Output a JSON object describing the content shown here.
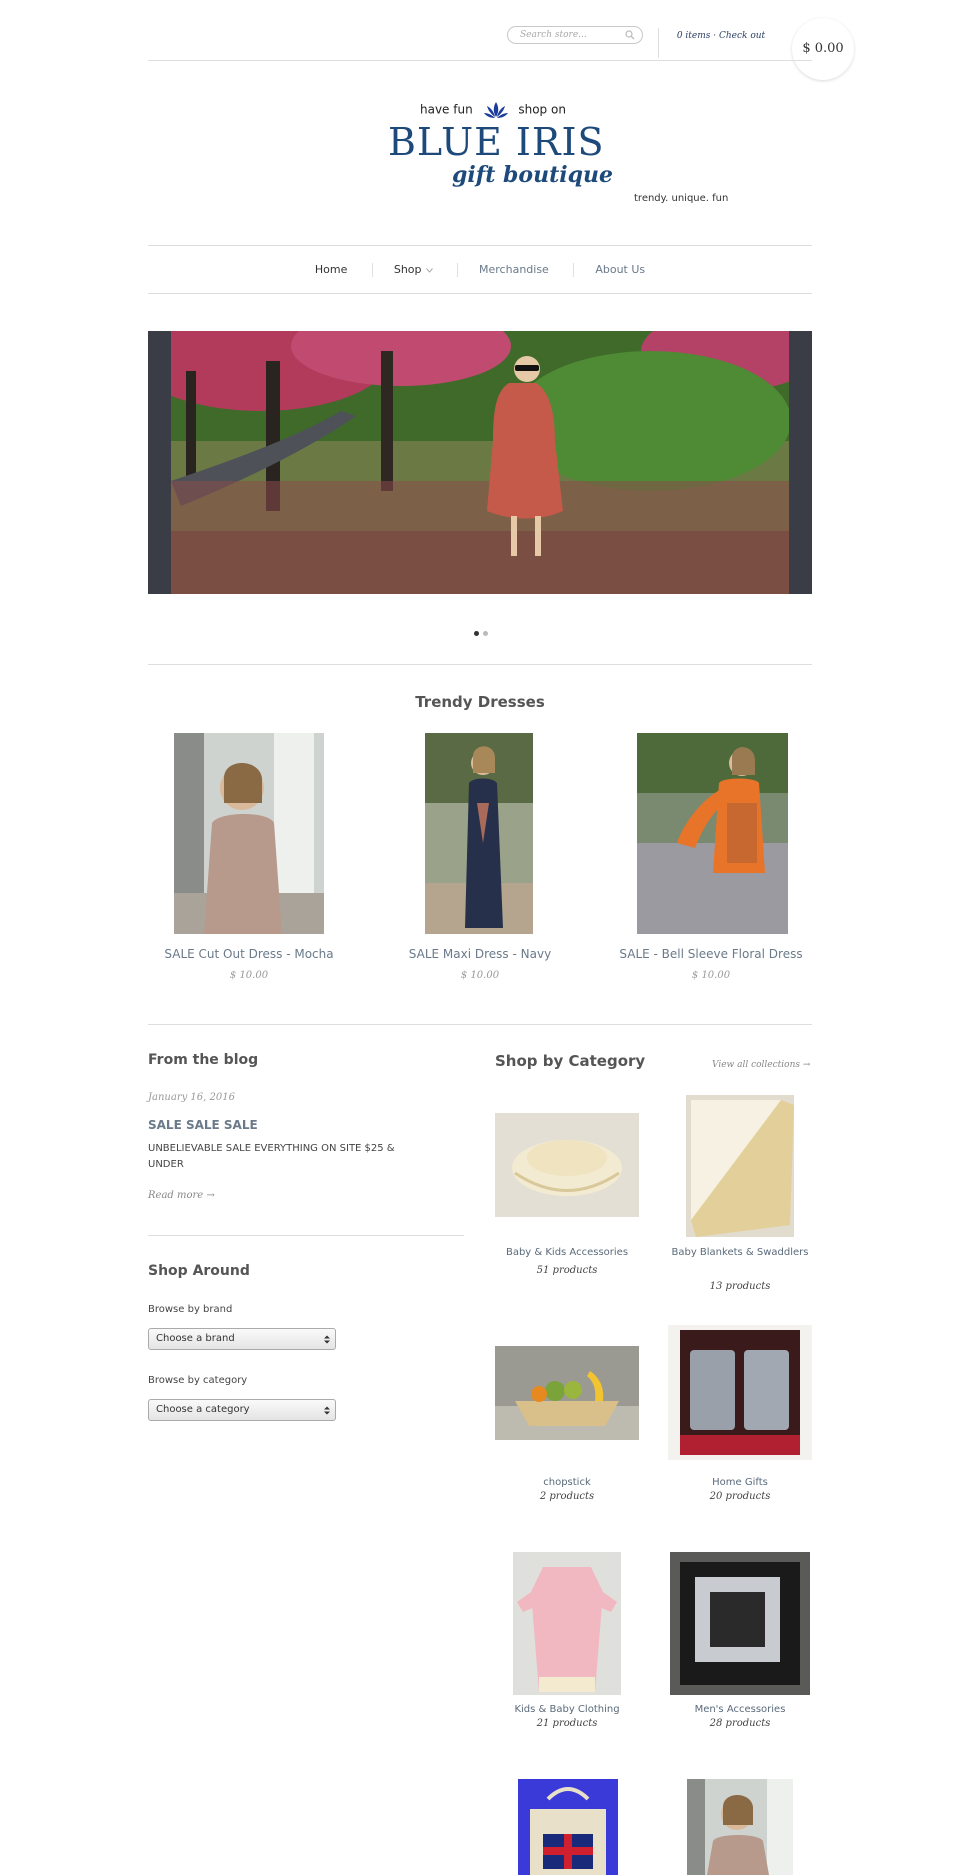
{
  "header": {
    "search_placeholder": "Search store...",
    "cart_items": "0 items",
    "checkout": "Check out",
    "cart_total": "$ 0.00"
  },
  "logo": {
    "top_left": "have fun",
    "top_right": "shop on",
    "title": "BLUE IRIS",
    "subtitle": "gift boutique",
    "tagline": "trendy. unique. fun"
  },
  "nav": {
    "items": [
      {
        "label": "Home"
      },
      {
        "label": "Shop"
      },
      {
        "label": "Merchandise"
      },
      {
        "label": "About Us"
      }
    ]
  },
  "slideshow": {
    "slide_count": 2,
    "active_index": 0
  },
  "dresses": {
    "heading": "Trendy Dresses",
    "products": [
      {
        "name": "SALE Cut Out Dress - Mocha",
        "price": "$ 10.00"
      },
      {
        "name": "SALE Maxi Dress - Navy",
        "price": "$ 10.00"
      },
      {
        "name": "SALE - Bell Sleeve Floral Dress",
        "price": "$ 10.00"
      }
    ]
  },
  "blog": {
    "heading": "From the blog",
    "date": "January 16, 2016",
    "post_title": "SALE SALE SALE",
    "excerpt": "UNBELIEVABLE SALE EVERYTHING ON SITE  $25 & UNDER",
    "read_more": "Read more →"
  },
  "shop_around": {
    "heading": "Shop Around",
    "brand_label": "Browse by brand",
    "brand_value": "Choose a brand",
    "category_label": "Browse by category",
    "category_value": "Choose a category"
  },
  "categories": {
    "heading": "Shop by Category",
    "view_all": "View all collections →",
    "items": [
      {
        "name": "Baby & Kids Accessories",
        "count": "51 products"
      },
      {
        "name": "Baby Blankets & Swaddlers",
        "count": "13 products"
      },
      {
        "name": "chopstick",
        "count": "2 products"
      },
      {
        "name": "Home Gifts",
        "count": "20 products"
      },
      {
        "name": "Kids & Baby Clothing",
        "count": "21 products"
      },
      {
        "name": "Men's Accessories",
        "count": "28 products"
      }
    ]
  },
  "colors": {
    "brand_blue": "#1d4a7a",
    "link": "#6a7a8a",
    "rule": "#dedede"
  }
}
